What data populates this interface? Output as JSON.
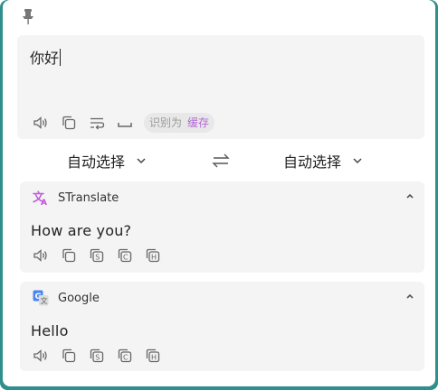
{
  "input": {
    "text": "你好",
    "detect_label": "识别为",
    "cache_label": "缓存"
  },
  "languages": {
    "source": "自动选择",
    "target": "自动选择"
  },
  "results": [
    {
      "engine": "STranslate",
      "text": "How are you?"
    },
    {
      "engine": "Google",
      "text": "Hello"
    }
  ],
  "colors": {
    "accent": "#b36ad6",
    "window_border": "#2f8f8c",
    "panel_bg": "#f4f4f4",
    "google_blue": "#4a86f0"
  }
}
